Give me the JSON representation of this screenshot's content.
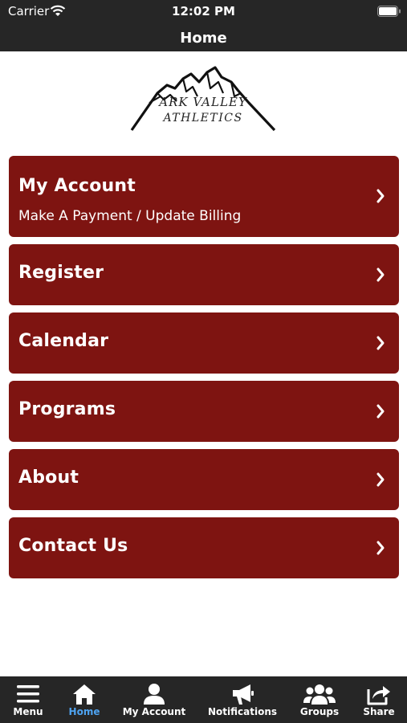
{
  "status_bar": {
    "carrier": "Carrier",
    "time": "12:02 PM"
  },
  "nav": {
    "title": "Home"
  },
  "logo": {
    "line1": "ARK VALLEY",
    "line2": "ATHLETICS"
  },
  "menu": [
    {
      "label": "My Account",
      "sublabel": "Make A Payment / Update Billing"
    },
    {
      "label": "Register"
    },
    {
      "label": "Calendar"
    },
    {
      "label": "Programs"
    },
    {
      "label": "About"
    },
    {
      "label": "Contact Us"
    }
  ],
  "tabs": [
    {
      "label": "Menu",
      "icon": "hamburger-icon",
      "active": false
    },
    {
      "label": "Home",
      "icon": "home-icon",
      "active": true
    },
    {
      "label": "My Account",
      "icon": "user-icon",
      "active": false
    },
    {
      "label": "Notifications",
      "icon": "megaphone-icon",
      "active": false
    },
    {
      "label": "Groups",
      "icon": "group-icon",
      "active": false
    },
    {
      "label": "Share",
      "icon": "share-icon",
      "active": false
    }
  ],
  "colors": {
    "bar": "#262626",
    "card": "#7e1411",
    "active_tab": "#4ea3f1"
  }
}
